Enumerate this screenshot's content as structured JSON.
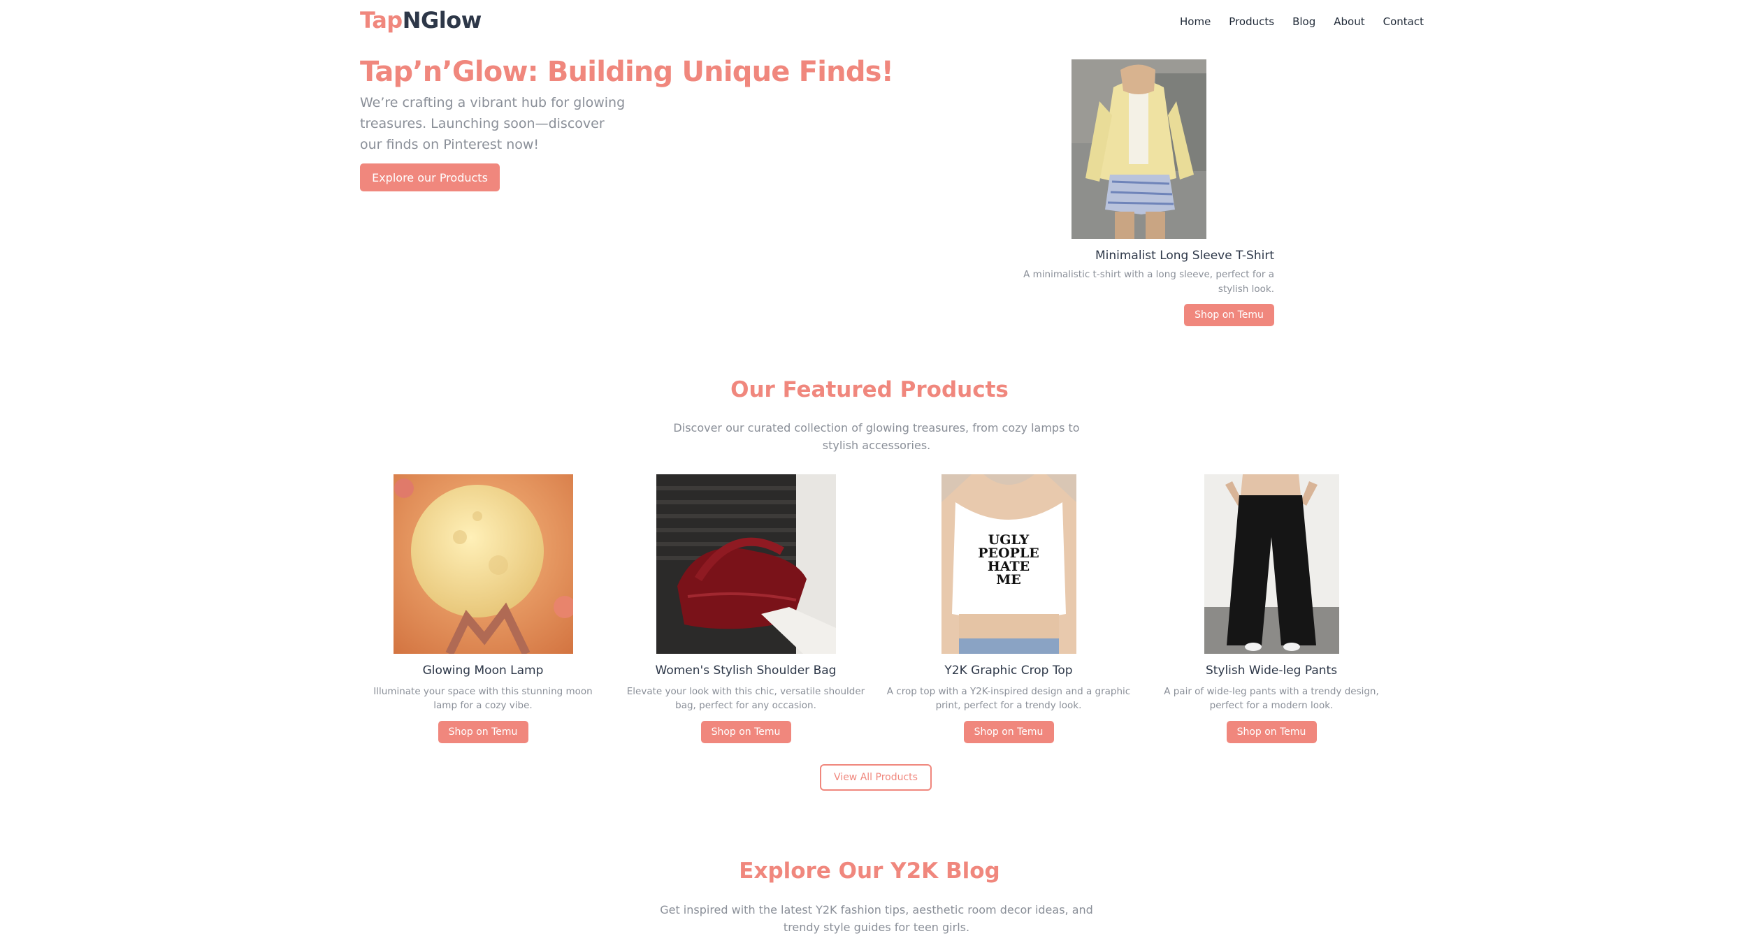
{
  "header": {
    "brand_part1": "Tap",
    "brand_part2": "NGlow",
    "nav": [
      "Home",
      "Products",
      "Blog",
      "About",
      "Contact"
    ]
  },
  "hero": {
    "title": "Tap’n’Glow: Building Unique Finds!",
    "subtitle": "We’re crafting a vibrant hub for glowing treasures. Launching soon—discover our finds on Pinterest now!",
    "cta": "Explore our Products",
    "product": {
      "name": "Minimalist Long Sleeve T-Shirt",
      "description": "A minimalistic t-shirt with a long sleeve, perfect for a stylish look.",
      "button": "Shop on Temu"
    }
  },
  "featured": {
    "title": "Our Featured Products",
    "subtitle": "Discover our curated collection of glowing treasures, from cozy lamps to stylish accessories.",
    "products": [
      {
        "name": "Glowing Moon Lamp",
        "description": "Illuminate your space with this stunning moon lamp for a cozy vibe.",
        "button": "Shop on Temu"
      },
      {
        "name": "Women's Stylish Shoulder Bag",
        "description": "Elevate your look with this chic, versatile shoulder bag, perfect for any occasion.",
        "button": "Shop on Temu"
      },
      {
        "name": "Y2K Graphic Crop Top",
        "description": "A crop top with a Y2K-inspired design and a graphic print, perfect for a trendy look.",
        "button": "Shop on Temu",
        "shirt_text": "UGLY PEOPLE HATE ME"
      },
      {
        "name": "Stylish Wide-leg Pants",
        "description": "A pair of wide-leg pants with a trendy design, perfect for a modern look.",
        "button": "Shop on Temu"
      }
    ],
    "view_all": "View All Products"
  },
  "blog": {
    "title": "Explore Our Y2K Blog",
    "subtitle": "Get inspired with the latest Y2K fashion tips, aesthetic room decor ideas, and trendy style guides for teen girls."
  },
  "colors": {
    "accent": "#f0877d",
    "dark": "#2d3748",
    "muted": "#8a8f98"
  }
}
